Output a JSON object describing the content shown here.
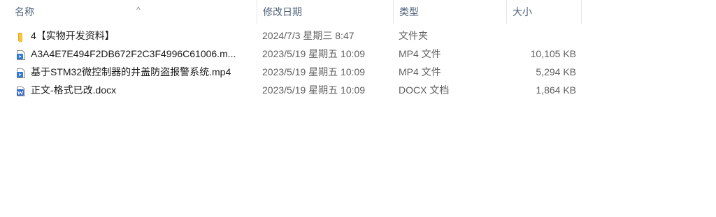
{
  "columns": {
    "name": "名称",
    "date": "修改日期",
    "type": "类型",
    "size": "大小"
  },
  "files": [
    {
      "icon": "folder-icon",
      "name": "4【实物开发资料】",
      "date": "2024/7/3 星期三 8:47",
      "type": "文件夹",
      "size": ""
    },
    {
      "icon": "video-file-icon",
      "name": "A3A4E7E494F2DB672F2C3F4996C61006.m...",
      "date": "2023/5/19 星期五 10:09",
      "type": "MP4 文件",
      "size": "10,105 KB"
    },
    {
      "icon": "video-file-icon",
      "name": "基于STM32微控制器的井盖防盗报警系统.mp4",
      "date": "2023/5/19 星期五 10:09",
      "type": "MP4 文件",
      "size": "5,294 KB"
    },
    {
      "icon": "word-document-icon",
      "name": "正文-格式已改.docx",
      "date": "2023/5/19 星期五 10:09",
      "type": "DOCX 文档",
      "size": "1,864 KB"
    }
  ],
  "colors": {
    "header_text": "#4c607a",
    "folder": "#f5c542",
    "video": "#2f7bd6",
    "word": "#2b64c9"
  }
}
